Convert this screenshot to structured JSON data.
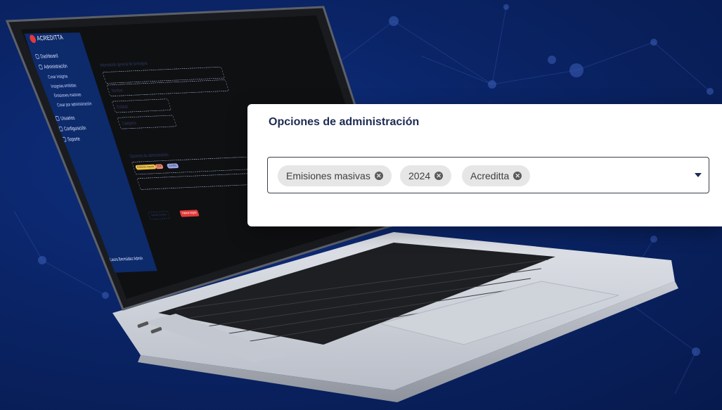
{
  "panel": {
    "title": "Opciones de administración",
    "tags": [
      {
        "label": "Emisiones masivas"
      },
      {
        "label": "2024"
      },
      {
        "label": "Acreditta"
      }
    ],
    "dropdown_icon": "chevron-down-icon"
  },
  "laptop_screen": {
    "brand": "ACREDITTA",
    "sidebar_items": [
      "Dashboard",
      "Administración",
      "Usuarios",
      "Configuración",
      "Soporte"
    ],
    "sidebar_sub_items": [
      "Crear insignia",
      "Insignias emitidas",
      "Emisiones masivas",
      "Crear por administración"
    ],
    "section_title": "Información general de la insignia",
    "fields": [
      "Nombre",
      "Descripción",
      "Entidad",
      "Categoría"
    ],
    "admin_section": "Opciones de administración",
    "chips": [
      "Emisiones masivas",
      "2024",
      "Acreditta"
    ],
    "buttons": {
      "secondary": "Guardar borrador",
      "primary": "Publicar insignia"
    },
    "user": "Laura Bermúdez Admin"
  },
  "colors": {
    "background": "#0a2466",
    "sidebar": "#0d2a6b",
    "accent": "#e23a3a",
    "tag_bg": "#e6e6e6"
  }
}
